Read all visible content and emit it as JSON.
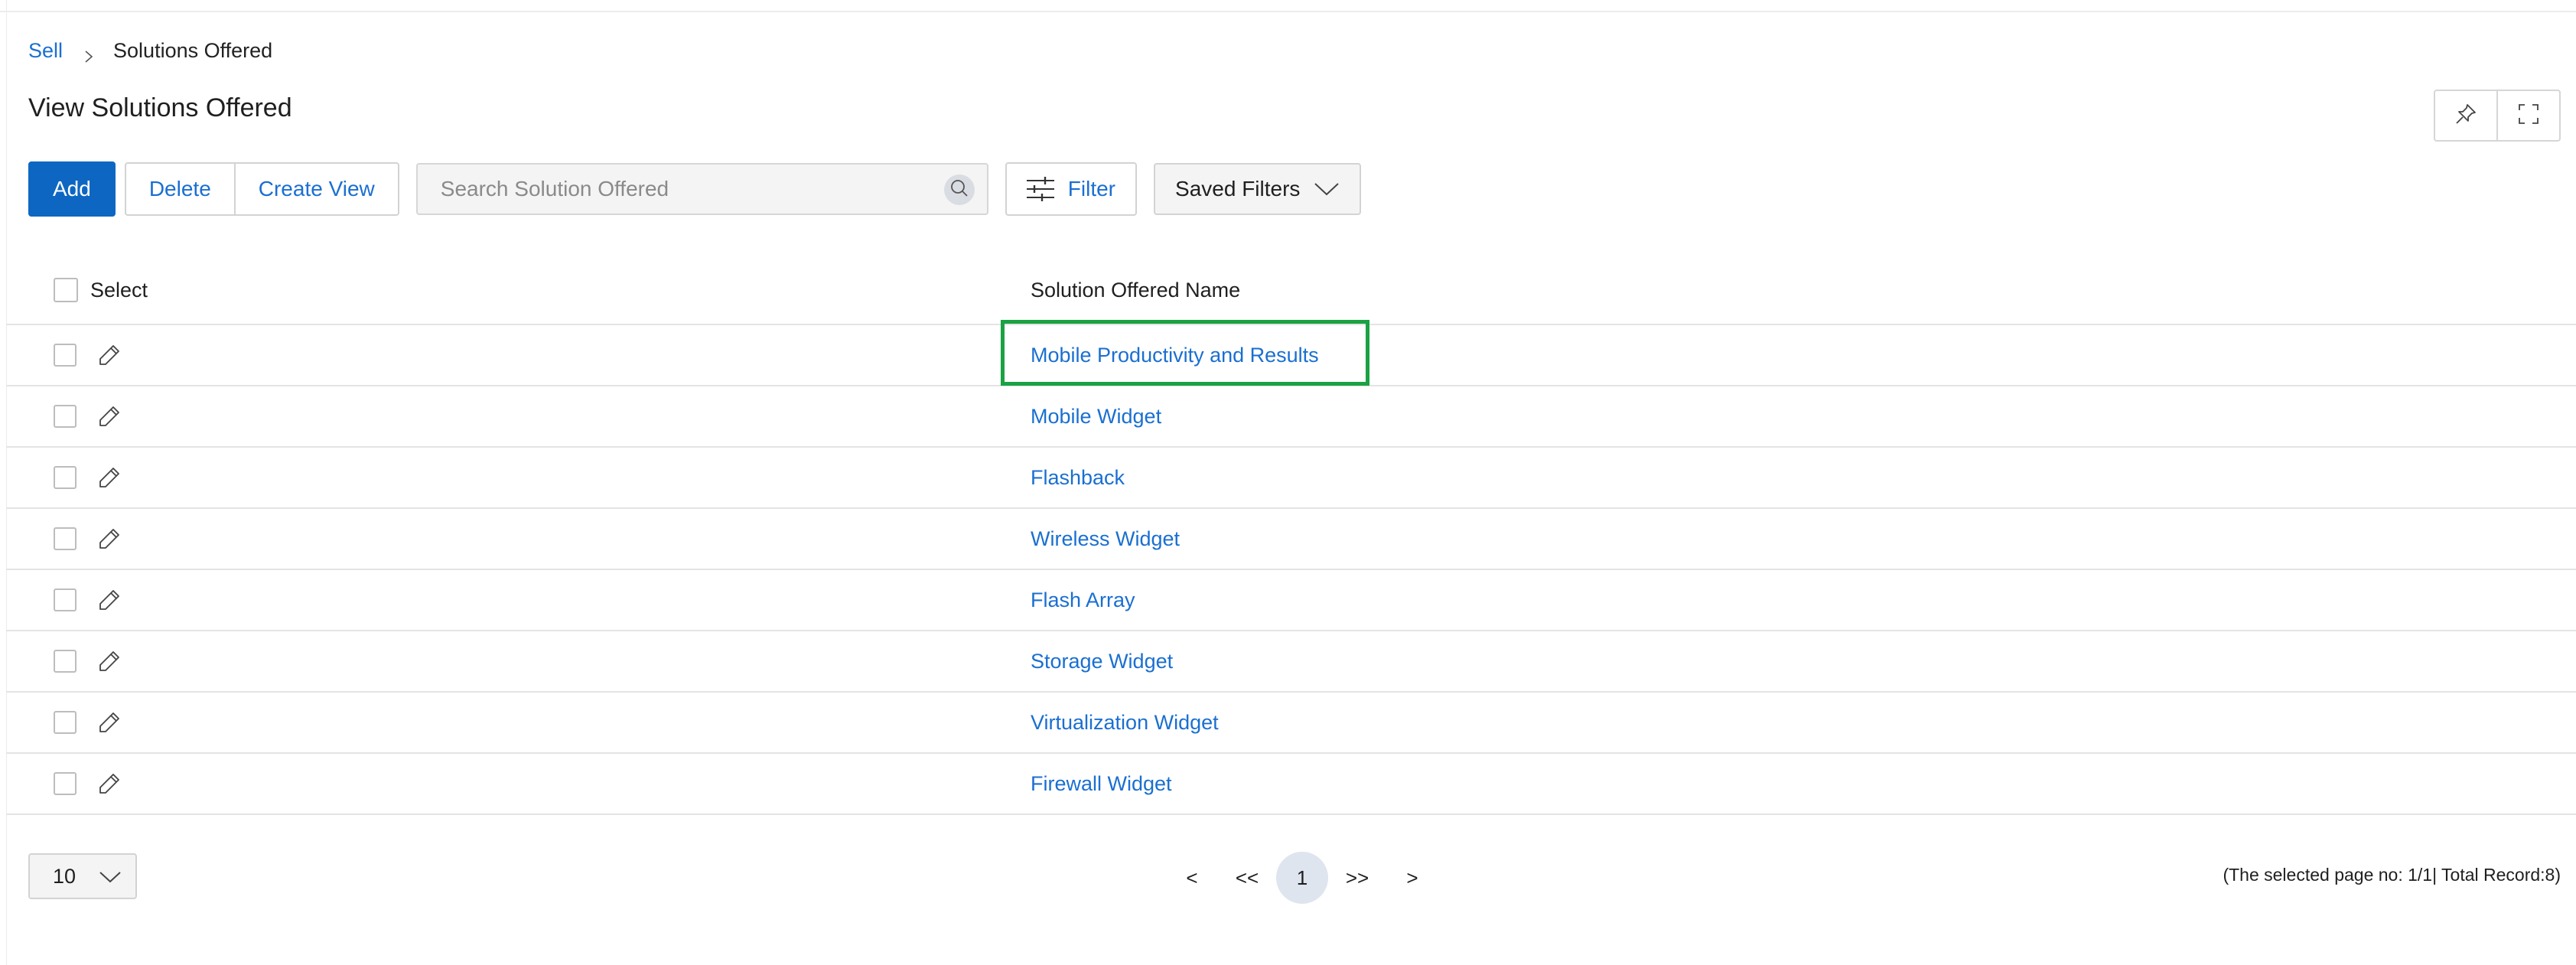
{
  "breadcrumb": {
    "parent": "Sell",
    "current": "Solutions Offered"
  },
  "page": {
    "title": "View Solutions Offered"
  },
  "toolbar": {
    "add_label": "Add",
    "delete_label": "Delete",
    "create_view_label": "Create View",
    "filter_label": "Filter",
    "saved_filters_label": "Saved Filters"
  },
  "search": {
    "placeholder": "Search Solution Offered",
    "value": ""
  },
  "table": {
    "columns": [
      "Select",
      "Solution Offered Name"
    ],
    "rows": [
      {
        "name": "Mobile Productivity and Results",
        "highlighted": true
      },
      {
        "name": "Mobile Widget"
      },
      {
        "name": "Flashback"
      },
      {
        "name": "Wireless Widget"
      },
      {
        "name": "Flash Array"
      },
      {
        "name": "Storage Widget"
      },
      {
        "name": "Virtualization Widget"
      },
      {
        "name": "Firewall Widget"
      }
    ]
  },
  "pagination": {
    "page_size": "10",
    "prev": "<",
    "first": "<<",
    "current": "1",
    "last": ">>",
    "next": ">",
    "info": "(The selected page no: 1/1| Total Record:8)"
  },
  "colors": {
    "accent": "#0d67c2",
    "link": "#1a6fd1",
    "highlight": "#1aa243"
  }
}
